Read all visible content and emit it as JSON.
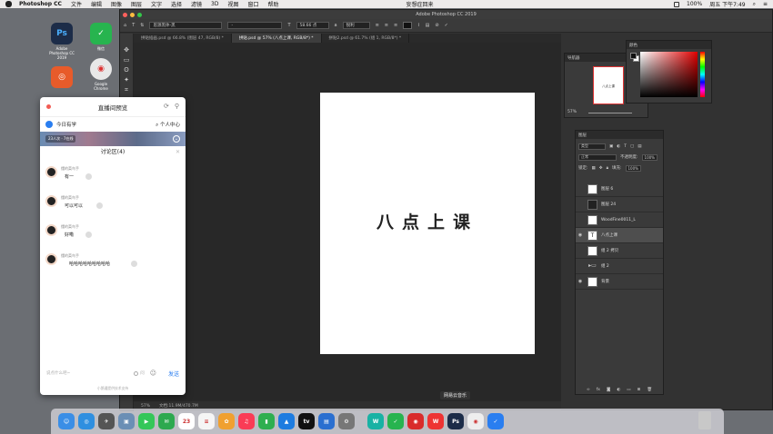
{
  "menubar": {
    "app": "Photoshop CC",
    "items": [
      "文件",
      "编辑",
      "图像",
      "图层",
      "文字",
      "选择",
      "滤镜",
      "3D",
      "视图",
      "窗口",
      "帮助"
    ],
    "center_text": "妄想症回来",
    "battery": "100%",
    "clock": "周五 下午7:49"
  },
  "desktop_icons": [
    {
      "label": "Adobe Photoshop CC 2019",
      "glyph": "Ps",
      "color": "#1c2c48"
    },
    {
      "label": "微信",
      "glyph": "✓",
      "color": "#27b44f"
    },
    {
      "label": "",
      "glyph": "◎",
      "color": "#e85b2a"
    },
    {
      "label": "Google Chrome",
      "glyph": "◉",
      "color": "#e8e8e8"
    }
  ],
  "photoshop": {
    "window_title": "Adobe Photoshop CC 2019",
    "options": {
      "font": "思源黑体-黑",
      "style": "-",
      "size": "58.66 点",
      "aa": "锐利"
    },
    "tabs": [
      {
        "label": "拼贴插画.psd @ 66.8% (图层 47, RGB/8) *",
        "active": false
      },
      {
        "label": "拼贴.psd @ 57% (八点上课, RGB/8*) *",
        "active": true
      },
      {
        "label": "拼贴2.psd @ 61.7% (组 1, RGB/8*) *",
        "active": false
      }
    ],
    "canvas_text": "八点上课",
    "status": {
      "zoom": "57%",
      "doc": "文档:11.9M/470.7M"
    }
  },
  "navigator": {
    "title": "导航器",
    "zoom": "57%",
    "thumb_text": "八点上课"
  },
  "color_panel": {
    "title": "颜色"
  },
  "layers": {
    "title": "图层",
    "kind": "类型",
    "blend": "正常",
    "opacity_label": "不透明度:",
    "opacity": "100%",
    "lock_label": "锁定:",
    "fill_label": "填充:",
    "fill": "100%",
    "rows": [
      {
        "name": "图层 6",
        "thumb": "",
        "visible": false,
        "selected": false
      },
      {
        "name": "图层 24",
        "thumb": "dark",
        "visible": false,
        "selected": false
      },
      {
        "name": "WoodFine0011_L",
        "thumb": "",
        "visible": false,
        "selected": false
      },
      {
        "name": "八点上课",
        "thumb": "T",
        "visible": true,
        "selected": true
      },
      {
        "name": "组 2 拷贝",
        "thumb": "",
        "visible": false,
        "selected": false
      },
      {
        "name": "组 2",
        "thumb": "folder",
        "visible": false,
        "selected": false
      },
      {
        "name": "背景",
        "thumb": "",
        "visible": true,
        "selected": false
      }
    ]
  },
  "live": {
    "title": "直播间预览",
    "brand": "今日有学",
    "center_link": "个人中心",
    "video_info": "23人次 · 7在线",
    "section_title": "讨论区(4)",
    "messages": [
      {
        "user": "懂的菜鸟手",
        "text": "有一"
      },
      {
        "user": "懂的菜鸟手",
        "text": "可以可以"
      },
      {
        "user": "懂的菜鸟手",
        "text": "好嘞"
      },
      {
        "user": "懂的菜鸟手",
        "text": "哈哈哈哈哈哈哈哈哈"
      }
    ],
    "input_placeholder": "说点什么吧~",
    "anonymous": "问",
    "send_label": "发送",
    "footer": "小鹅通提供技术支持"
  },
  "dock": {
    "tooltip": "网易云音乐",
    "icons": [
      {
        "name": "finder",
        "glyph": "☺",
        "color": "#3a8ee6"
      },
      {
        "name": "safari",
        "glyph": "◎",
        "color": "#2f8fe0"
      },
      {
        "name": "launchpad",
        "glyph": "✈",
        "color": "#555"
      },
      {
        "name": "preview",
        "glyph": "▣",
        "color": "#6b8fb5"
      },
      {
        "name": "facetime",
        "glyph": "▶",
        "color": "#34c759"
      },
      {
        "name": "messages",
        "glyph": "✉",
        "color": "#2da94f"
      },
      {
        "name": "calendar",
        "glyph": "23",
        "color": "#fff"
      },
      {
        "name": "notes",
        "glyph": "≡",
        "color": "#f5f5f5"
      },
      {
        "name": "photos",
        "glyph": "✿",
        "color": "#f0a030"
      },
      {
        "name": "music",
        "glyph": "♫",
        "color": "#fa3c56"
      },
      {
        "name": "numbers",
        "glyph": "▮",
        "color": "#2eaf4f"
      },
      {
        "name": "keynote",
        "glyph": "▲",
        "color": "#1d7ce0"
      },
      {
        "name": "appletv",
        "glyph": "tv",
        "color": "#111"
      },
      {
        "name": "keynote2",
        "glyph": "▤",
        "color": "#2a6fd0"
      },
      {
        "name": "system-prefs",
        "glyph": "⚙",
        "color": "#777"
      },
      {
        "name": "unknown",
        "glyph": "W",
        "color": "#18b2a4"
      },
      {
        "name": "wechat",
        "glyph": "✓",
        "color": "#27b44f"
      },
      {
        "name": "netease",
        "glyph": "◉",
        "color": "#d92b2b"
      },
      {
        "name": "wps",
        "glyph": "W",
        "color": "#e33"
      },
      {
        "name": "photoshop",
        "glyph": "Ps",
        "color": "#1c2c48"
      },
      {
        "name": "chrome",
        "glyph": "◉",
        "color": "#eee"
      },
      {
        "name": "check",
        "glyph": "✓",
        "color": "#2a7ef0"
      }
    ]
  }
}
